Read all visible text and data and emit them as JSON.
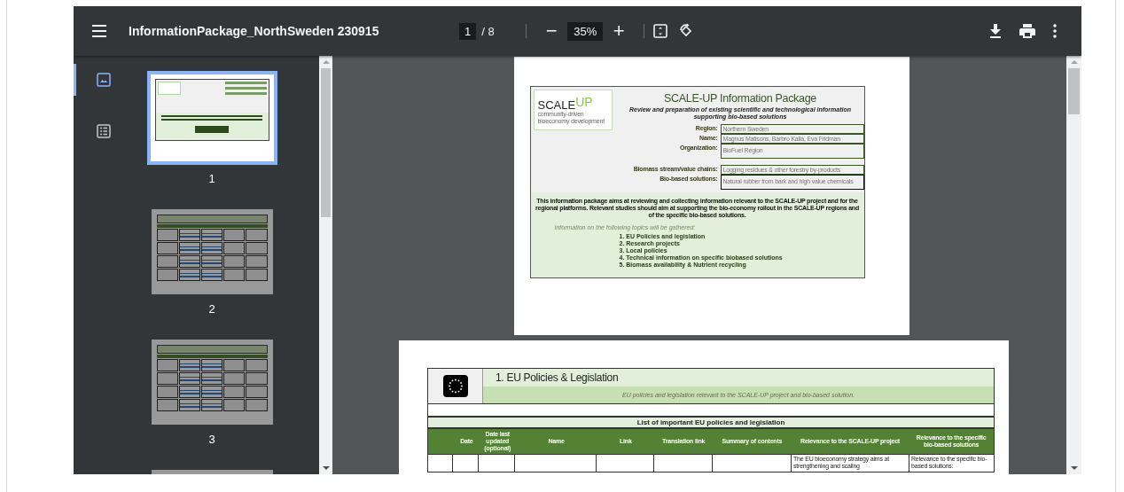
{
  "toolbar": {
    "title": "InformationPackage_NorthSweden 230915",
    "page_current": "1",
    "page_separator": "/",
    "page_total": "8",
    "zoom": "35%",
    "zoom_out": "−",
    "zoom_in": "+"
  },
  "sidebar": {
    "views": [
      {
        "kind": "thumbnails",
        "selected": true
      },
      {
        "kind": "outline",
        "selected": false
      }
    ],
    "thumbnails": [
      {
        "kind": "cover",
        "label": "1",
        "selected": true
      },
      {
        "kind": "table",
        "label": "2",
        "selected": false
      },
      {
        "kind": "table",
        "label": "3",
        "selected": false
      },
      {
        "kind": "table",
        "selected": false
      }
    ]
  },
  "document": {
    "pages": [
      {
        "kind": "cover",
        "logo": {
          "word": "SCALE",
          "accent": "UP",
          "tagline_1": "community-driven",
          "tagline_2": "bioeconomy development"
        },
        "title": "SCALE-UP Information Package",
        "subtitle": "Review and preparation of existing scientific and technological information supporting bio-based solutions",
        "fields": [
          {
            "label": "Region:",
            "value": "Northern Sweden"
          },
          {
            "label": "Name:",
            "value": "Magnus Matisons, Barbro Kalla, Eva Fridman"
          },
          {
            "label": "Organization:",
            "value": "BioFuel Region"
          },
          {
            "label": "Biomass stream/value chains:",
            "value": "Logging residues & other forestry by-products"
          },
          {
            "label": "Bio-based solutions:",
            "value": "Natural rubber from bark and high value chemicals"
          }
        ],
        "intro": "This information package aims at reviewing and collecting information relevant to the SCALE-UP project and for the regional platforms. Relevant studies should aim at supporting the bio-economy rollout in the SCALE-UP regions and of the specific bio-based solutions.",
        "topics_heading": "Information on the following topics will be gathered:",
        "topics": [
          "1. EU Policies and legislation",
          "2. Research projects",
          "3. Local policies",
          "4. Technical information on specific biobased solutions",
          "5. Biomass availability & Nutrient recycling"
        ]
      },
      {
        "kind": "table",
        "heading": "1. EU Policies & Legislation",
        "description": "EU policies and legislation relevant to the SCALE-UP project and bio-based solution.",
        "table_title": "List of important EU policies and legislation",
        "columns": [
          "",
          "Date",
          "Date last updated (optional)",
          "Name",
          "Link",
          "Translation link",
          "Summary of contents",
          "Relevance to the SCALE-UP project",
          "Relevance to the specific bio-based solutions"
        ],
        "rows": [
          [
            "",
            "",
            "",
            "",
            "",
            "",
            "",
            "The EU bioeconomy strategy aims at strengthening and scaling",
            "Relevance to the specific bio-based solutions:"
          ]
        ]
      }
    ]
  }
}
